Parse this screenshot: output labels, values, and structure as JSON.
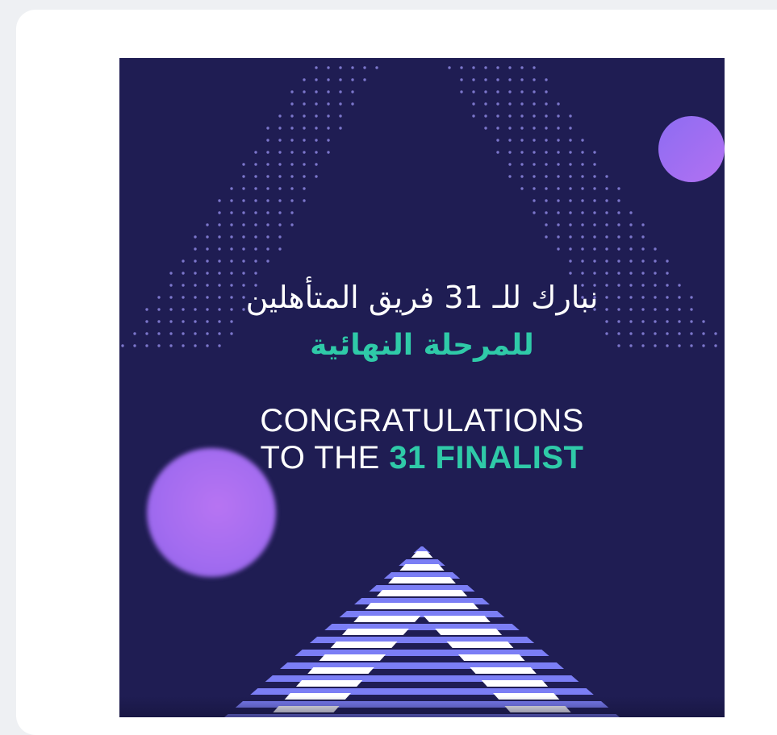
{
  "post": {
    "arabic_line_1": "نبارك للـ 31 فريق المتأهلين",
    "arabic_line_2": "للمرحلة النهائية",
    "english_line_1": "CONGRATULATIONS",
    "english_line_2_prefix": "TO THE ",
    "english_line_2_highlight": "31 FINALIST"
  },
  "colors": {
    "background": "#1f1d53",
    "accent_teal": "#2fcaa8",
    "purple_blob": "#a36cf0",
    "stripe_blue": "#7b7ef5"
  },
  "icons": {
    "chevron": "up-chevron-graphic",
    "dots": "dot-pattern"
  }
}
